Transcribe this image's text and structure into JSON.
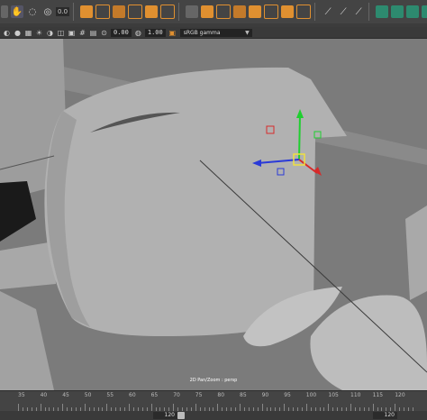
{
  "toolbar": {
    "value_a": "0.0",
    "tools": [
      "select-tool",
      "lasso-tool",
      "paint-tool",
      "move-tool",
      "rotate-tool",
      "scale-tool",
      "snap-grid",
      "snap-curve",
      "snap-point",
      "snap-surface",
      "history",
      "render",
      "ipr",
      "render-settings",
      "hypershade",
      "light-editor"
    ]
  },
  "viewpanel": {
    "exposure": "0.00",
    "gamma": "1.00",
    "color_space": "sRGB gamma"
  },
  "hud": {
    "camera_label": "2D Pan/Zoom : persp"
  },
  "timeline": {
    "ticks": [
      "35",
      "40",
      "45",
      "50",
      "55",
      "60",
      "65",
      "70",
      "75",
      "80",
      "85",
      "90",
      "95",
      "100",
      "105",
      "110",
      "115",
      "120"
    ],
    "range_start": "120",
    "range_end": "120"
  }
}
